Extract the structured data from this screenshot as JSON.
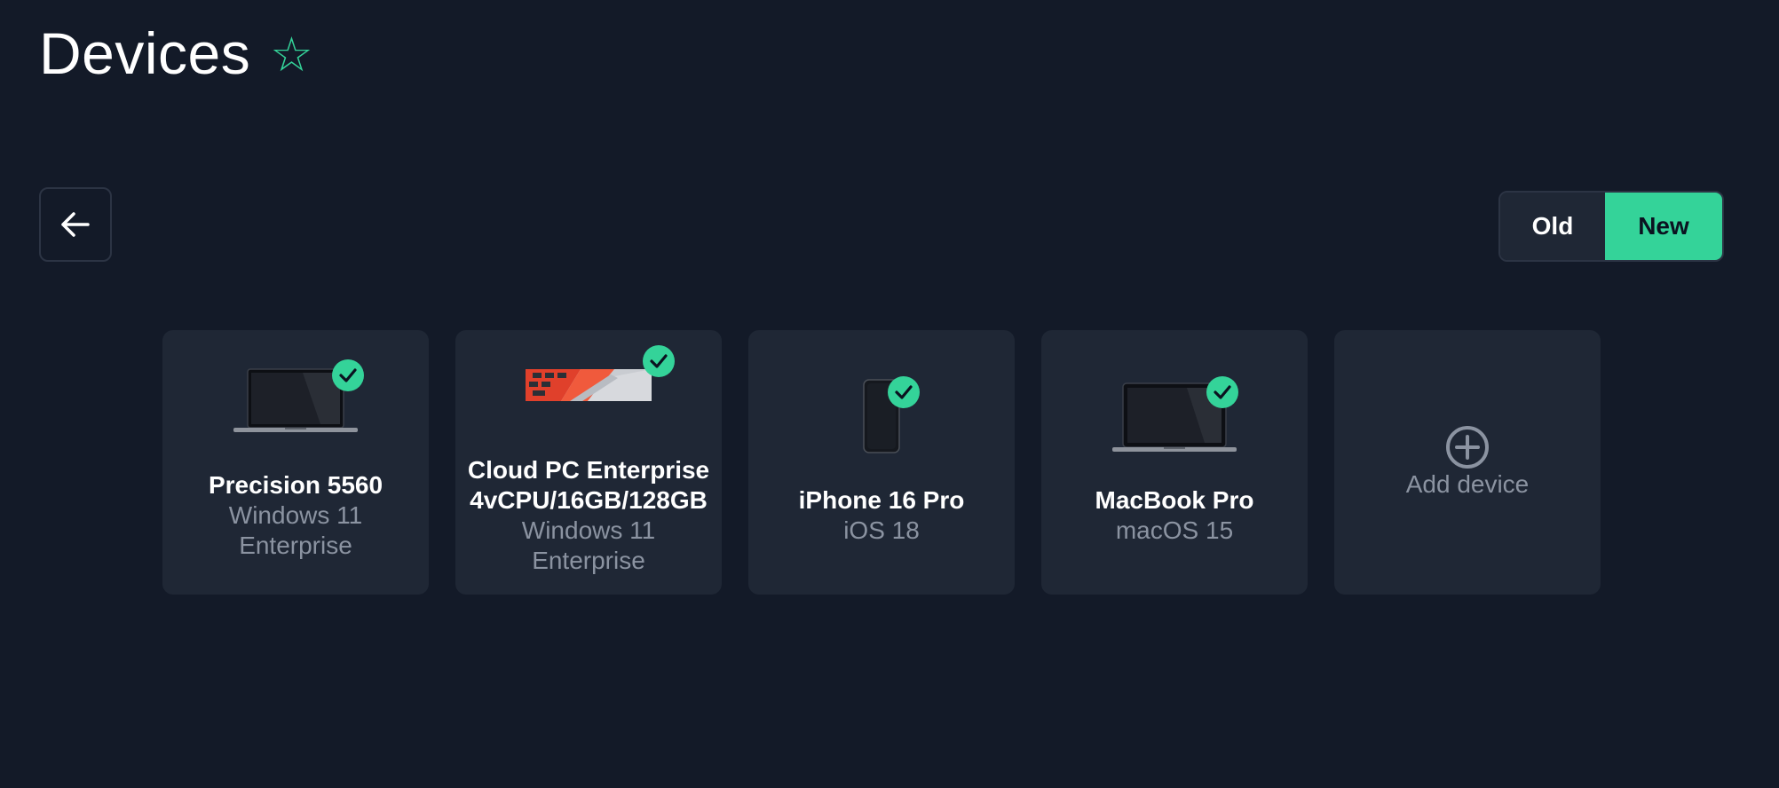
{
  "header": {
    "title": "Devices",
    "favorite_icon": "star-outline-icon",
    "accent_color": "#34d399"
  },
  "toolbar": {
    "back_icon": "arrow-left-icon",
    "toggle": {
      "options": [
        "Old",
        "New"
      ],
      "selected": "New"
    }
  },
  "devices": [
    {
      "name": "Precision 5560",
      "os_line1": "Windows 11",
      "os_line2": "Enterprise",
      "image": "laptop",
      "status": "check"
    },
    {
      "name_line1": "Cloud PC Enterprise",
      "name_line2": "4vCPU/16GB/128GB",
      "os_line1": "Windows 11",
      "os_line2": "Enterprise",
      "image": "cloud-pc-banner",
      "status": "check"
    },
    {
      "name": "iPhone 16 Pro",
      "os": "iOS 18",
      "image": "phone",
      "status": "check"
    },
    {
      "name": "MacBook Pro",
      "os": "macOS 15",
      "image": "laptop",
      "status": "check"
    }
  ],
  "add_device": {
    "label": "Add device",
    "icon": "plus-circle-icon"
  }
}
